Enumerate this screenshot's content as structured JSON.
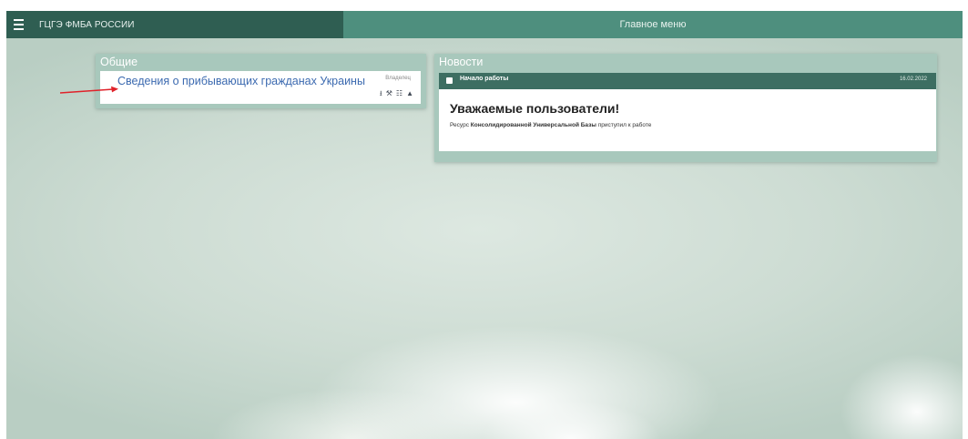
{
  "topbar": {
    "menu_icon": "hamburger-icon",
    "app_title": "ГЦГЭ ФМБА РОССИИ",
    "center_title": "Главное меню"
  },
  "general_panel": {
    "title": "Общие",
    "card": {
      "link_text": "Сведения о прибывающих гражданах Украины",
      "owner_label": "Владелец",
      "icons": [
        "download-icon",
        "wrench-icon",
        "sitemap-icon",
        "user-icon"
      ]
    }
  },
  "news_panel": {
    "title": "Новости",
    "item": {
      "header_title": "Начало работы",
      "date": "16.02.2022",
      "heading": "Уважаемые пользователи!",
      "text_prefix": "Ресурс",
      "text_bold": "Консолидированной Универсальной Базы",
      "text_suffix": "приступил к работе"
    }
  },
  "colors": {
    "topbar": "#4e8f7e",
    "topbar_left": "#2f5e52",
    "panel_bg": "#a8c8bc",
    "news_header": "#3d6e62",
    "link": "#3c6ab0",
    "annotation_arrow": "#e0222a"
  }
}
